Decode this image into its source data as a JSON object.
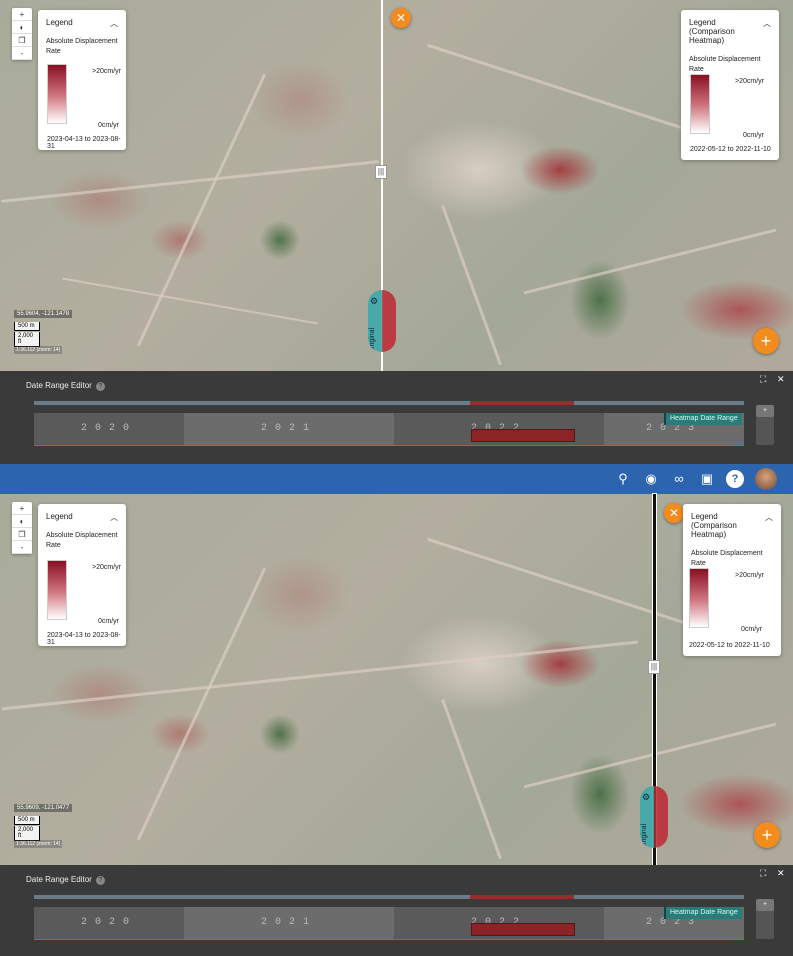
{
  "legend_left": {
    "title": "Legend",
    "subtitle": "Absolute Displacement Rate",
    "max": ">20cm/yr",
    "min": "0cm/yr",
    "dates": "2023-04-13 to 2023-08-31"
  },
  "legend_right": {
    "title": "Legend",
    "subtitle_line2": "(Comparison Heatmap)",
    "subtitle": "Absolute Displacement Rate",
    "max": ">20cm/yr",
    "min": "0cm/yr",
    "dates": "2022-05-12 to 2022-11-10"
  },
  "panel1": {
    "coords": "55.9604, -121.1478",
    "zoom_text": "1:36.112 (zoom: 14)"
  },
  "panel2": {
    "coords": "55.9609, -121.0477",
    "zoom_text": "1:36.112 (zoom: 14)"
  },
  "scale": {
    "m": "500 m",
    "ft": "2,000 ft"
  },
  "zoom_controls": {
    "plus": "+",
    "minus": "-"
  },
  "swipe": {
    "label_original": "Original",
    "label_comparison": "Comparison"
  },
  "date_range_editor": {
    "title": "Date Range Editor",
    "help": "?",
    "years": [
      "2020",
      "2021",
      "2022",
      "2023"
    ],
    "heatmap_label": "Heatmap Date Range",
    "expand": "⛶",
    "close": "✕",
    "mini_plus": "+"
  },
  "fab": {
    "close": "✕",
    "add": "+"
  },
  "colors": {
    "accent": "#f28c1e",
    "topbar": "#2c65ad",
    "heat_high": "#8a0f22"
  },
  "topbar_icons": [
    "search-icon",
    "location-pin-icon",
    "link-icon",
    "bookmark-icon",
    "help-icon"
  ]
}
